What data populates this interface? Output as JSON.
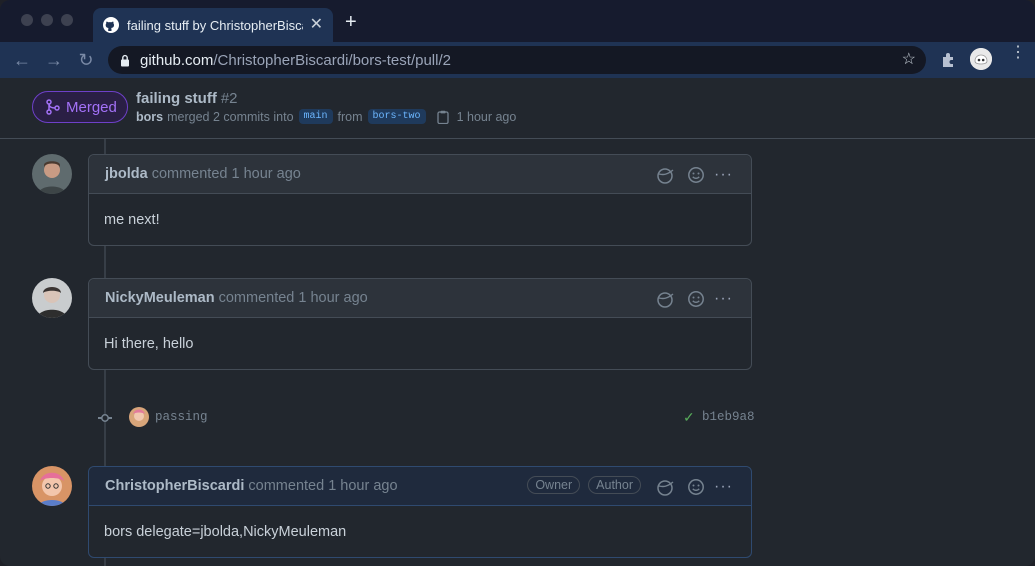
{
  "browser": {
    "tab_title": "failing stuff by ChristopherBiscardi",
    "url_host": "github.com",
    "url_path": "/ChristopherBiscardi/bors-test/pull/2"
  },
  "pr": {
    "status": "Merged",
    "title": "failing stuff",
    "number": "#2",
    "merged_by": "bors",
    "merged_text": "merged 2 commits into",
    "base_branch": "main",
    "from_text": "from",
    "head_branch": "bors-two",
    "time": "1 hour ago",
    "status_color": "#a371f7"
  },
  "comments": [
    {
      "author": "jbolda",
      "meta": "commented 1 hour ago",
      "body": "me next!"
    },
    {
      "author": "NickyMeuleman",
      "meta": "commented 1 hour ago",
      "body": "Hi there, hello"
    },
    {
      "author": "ChristopherBiscardi",
      "meta": "commented 1 hour ago",
      "labels": [
        "Owner",
        "Author"
      ],
      "body": "bors delegate=jbolda,NickyMeuleman"
    }
  ],
  "commit": {
    "message": "passing",
    "sha": "b1eb9a8",
    "check_icon": "check-icon"
  }
}
